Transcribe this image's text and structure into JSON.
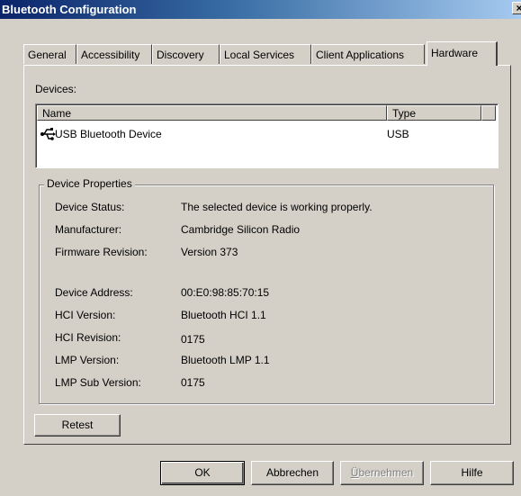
{
  "window": {
    "title": "Bluetooth Configuration",
    "close_glyph": "×"
  },
  "tabs": [
    {
      "label": "General"
    },
    {
      "label": "Accessibility"
    },
    {
      "label": "Discovery"
    },
    {
      "label": "Local Services"
    },
    {
      "label": "Client Applications"
    },
    {
      "label": "Hardware",
      "active": true
    }
  ],
  "devices": {
    "label": "Devices:",
    "columns": [
      "Name",
      "Type"
    ],
    "rows": [
      {
        "icon": "usb-icon",
        "name": "USB Bluetooth Device",
        "type": "USB"
      }
    ]
  },
  "properties": {
    "title": "Device Properties",
    "items": [
      {
        "label": "Device Status:",
        "value": "The selected device is working properly."
      },
      {
        "label": "Manufacturer:",
        "value": "Cambridge Silicon Radio"
      },
      {
        "label": "Firmware Revision:",
        "value": "Version 373"
      },
      {
        "label": "Device Address:",
        "value": "00:E0:98:85:70:15"
      },
      {
        "label": "HCI Version:",
        "value": "Bluetooth HCI 1.1"
      },
      {
        "label": "HCI Revision:",
        "value": "0175"
      },
      {
        "label": "LMP Version:",
        "value": "Bluetooth LMP 1.1"
      },
      {
        "label": "LMP Sub Version:",
        "value": "0175"
      }
    ]
  },
  "buttons": {
    "retest": "Retest",
    "ok": "OK",
    "cancel": "Abbrechen",
    "apply_first": "Ü",
    "apply_rest": "bernehmen",
    "help": "Hilfe"
  }
}
